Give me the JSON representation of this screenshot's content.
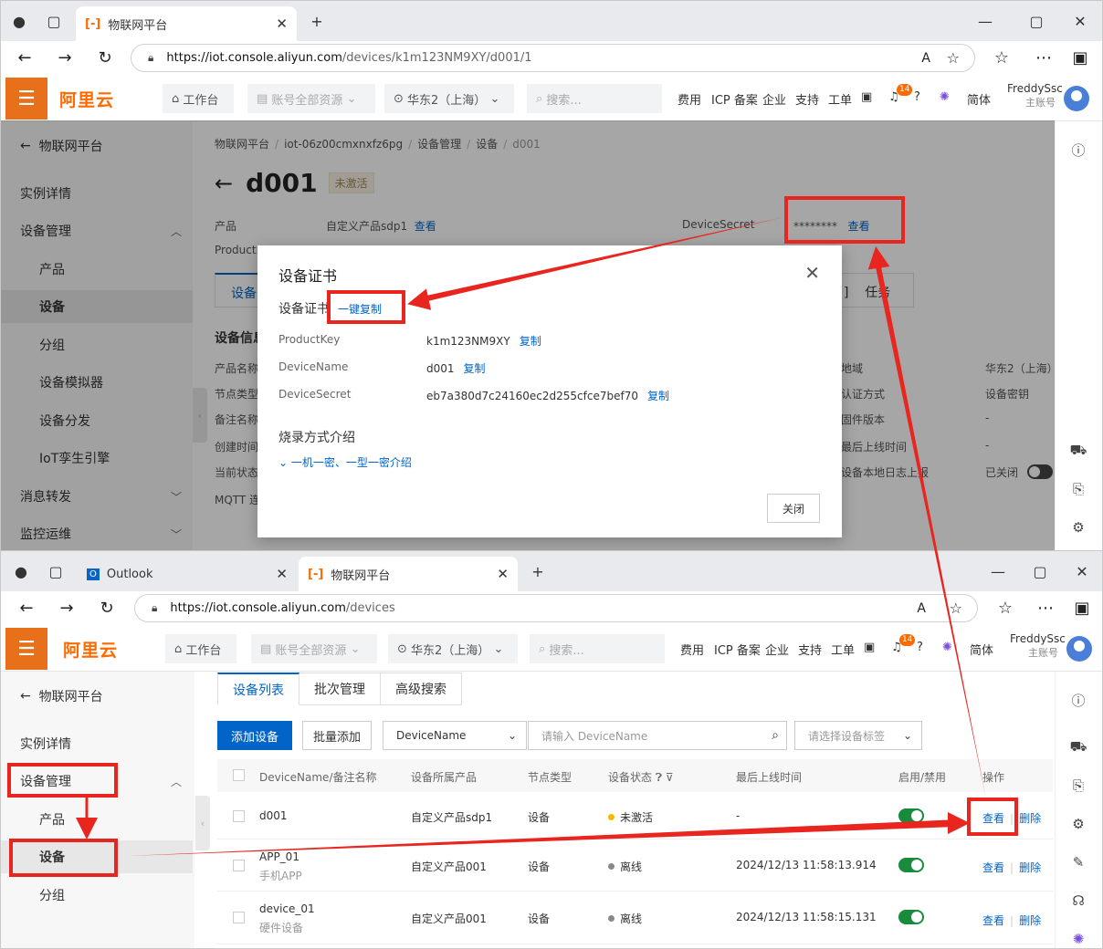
{
  "window1": {
    "tab_title": "物联网平台",
    "url_host": "https://iot.console.aliyun.com",
    "url_path": "/devices/k1m123NM9XY/d001/1",
    "header": {
      "logo": "阿里云",
      "workbench": "工作台",
      "resources": "账号全部资源",
      "region": "华东2（上海）",
      "search_placeholder": "搜索...",
      "links": [
        "费用",
        "ICP 备案",
        "企业",
        "支持",
        "工单"
      ],
      "badge": "14",
      "lang": "简体",
      "user": "FreddySsc",
      "user_sub": "主账号"
    },
    "sidebar": {
      "back": "物联网平台",
      "items": [
        "实例详情",
        "设备管理",
        "产品",
        "设备",
        "分组",
        "设备模拟器",
        "设备分发",
        "IoT孪生引擎",
        "消息转发",
        "监控运维"
      ]
    },
    "breadcrumb": [
      "物联网平台",
      "iot-06z00cmxnxfz6pg",
      "设备管理",
      "设备",
      "d001"
    ],
    "device": {
      "name": "d001",
      "status": "未激活",
      "product_label": "产品",
      "product_value": "自定义产品sdp1",
      "view": "查看",
      "productkey_partial": "ProductK",
      "secret_label": "DeviceSecret",
      "secret_masked": "********",
      "tab_partial_left": "设备",
      "tab_partial_right_1": "]",
      "tab_partial_right_2": "任务",
      "info_title": "设备信息",
      "left_labels": [
        "产品名称",
        "节点类型",
        "备注名称",
        "创建时间",
        "当前状态",
        "MQTT 连"
      ],
      "right_labels": [
        "地域",
        "认证方式",
        "固件版本",
        "最后上线时间",
        "设备本地日志上报"
      ],
      "right_values": [
        "华东2（上海）",
        "设备密钥",
        "-",
        "-",
        "已关闭"
      ]
    },
    "dialog": {
      "title": "设备证书",
      "subtitle": "设备证书",
      "copy_all": "一键复制",
      "fields": [
        {
          "key": "ProductKey",
          "value": "k1m123NM9XY"
        },
        {
          "key": "DeviceName",
          "value": "d001"
        },
        {
          "key": "DeviceSecret",
          "value": "eb7a380d7c24160ec2d255cfce7bef70"
        }
      ],
      "copy": "复制",
      "burn_title": "烧录方式介绍",
      "burn_link": "一机一密、一型一密介绍",
      "close": "关闭"
    }
  },
  "window2": {
    "tabs": [
      "Outlook",
      "物联网平台"
    ],
    "url_host": "https://iot.console.aliyun.com",
    "url_path": "/devices",
    "sidebar": {
      "back": "物联网平台",
      "items": [
        "实例详情",
        "设备管理",
        "产品",
        "设备",
        "分组"
      ]
    },
    "subtabs": [
      "设备列表",
      "批次管理",
      "高级搜索"
    ],
    "add_device": "添加设备",
    "batch_add": "批量添加",
    "filter_field": "DeviceName",
    "search_placeholder": "请输入 DeviceName",
    "tag_placeholder": "请选择设备标签",
    "columns": [
      "DeviceName/备注名称",
      "设备所属产品",
      "节点类型",
      "设备状态",
      "最后上线时间",
      "启用/禁用",
      "操作"
    ],
    "rows": [
      {
        "name": "d001",
        "note": "",
        "product": "自定义产品sdp1",
        "node": "设备",
        "status": "未激活",
        "status_color": "#f5b800",
        "last": "-",
        "enabled": true
      },
      {
        "name": "APP_01",
        "note": "手机APP",
        "product": "自定义产品001",
        "node": "设备",
        "status": "离线",
        "status_color": "#888888",
        "last": "2024/12/13 11:58:13.914",
        "enabled": true
      },
      {
        "name": "device_01",
        "note": "硬件设备",
        "product": "自定义产品001",
        "node": "设备",
        "status": "离线",
        "status_color": "#888888",
        "last": "2024/12/13 11:58:15.131",
        "enabled": true
      }
    ],
    "action_view": "查看",
    "action_delete": "删除"
  },
  "colors": {
    "accent": "#0064c8",
    "brand": "#ff6a00",
    "annotation": "#e8251f"
  }
}
